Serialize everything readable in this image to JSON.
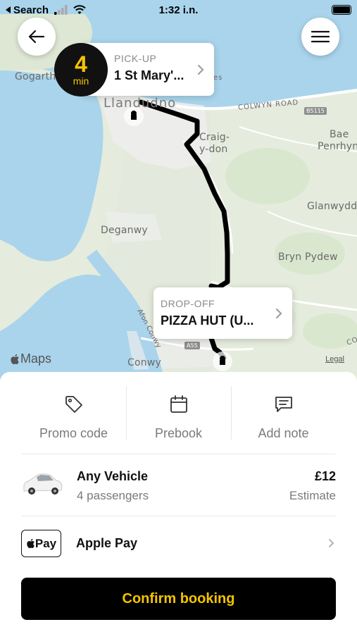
{
  "status_bar": {
    "back_app": "Search",
    "time": "1:32 i.n."
  },
  "map": {
    "labels": {
      "gogarth": "Gogarth",
      "llandudno": "Llandudno",
      "colwyn_road": "COLWYN ROAD",
      "b5115": "B5115",
      "craig_y_don_1": "Craig-",
      "craig_y_don_2": "y-don",
      "bae_penrhyn_1": "Bae",
      "bae_penrhyn_2": "Penrhyn",
      "glanwydden": "Glanwydd",
      "deganwy": "Deganwy",
      "bryn_pydew": "Bryn Pydew",
      "afon_conwy": "Afon Conwy",
      "a55": "A55",
      "conwy": "Conwy",
      "coed": "COE",
      "es": "es"
    },
    "attribution": "Maps",
    "legal": "Legal"
  },
  "eta": {
    "value": "4",
    "unit": "min"
  },
  "pickup": {
    "caption": "PICK-UP",
    "value": "1 St Mary'..."
  },
  "dropoff": {
    "caption": "DROP-OFF",
    "value": "PIZZA HUT (U..."
  },
  "actions": [
    {
      "label": "Promo code",
      "icon": "tag-icon"
    },
    {
      "label": "Prebook",
      "icon": "calendar-icon"
    },
    {
      "label": "Add note",
      "icon": "note-icon"
    }
  ],
  "vehicle": {
    "title": "Any Vehicle",
    "subtitle": "4 passengers",
    "price": "£12",
    "price_note": "Estimate"
  },
  "payment": {
    "badge": "Pay",
    "label": "Apple Pay"
  },
  "confirm_label": "Confirm booking",
  "colors": {
    "accent": "#f5c400",
    "dark": "#111111",
    "water": "#a9d4ec",
    "land": "#e7eee0"
  }
}
